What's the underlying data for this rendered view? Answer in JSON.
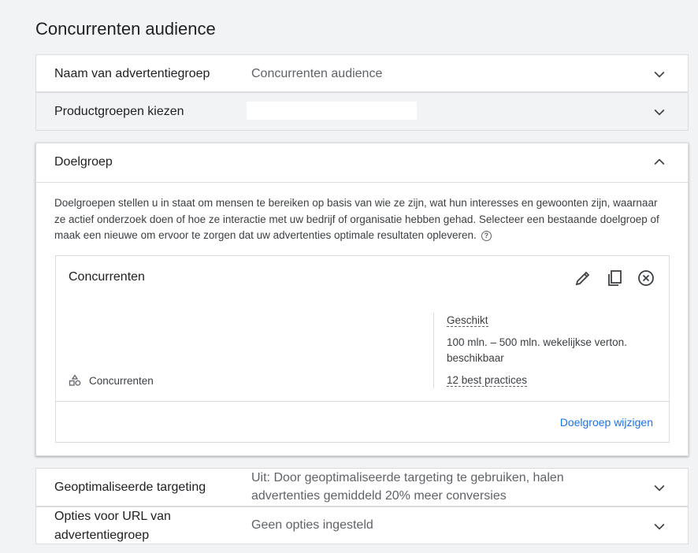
{
  "page": {
    "title": "Concurrenten audience"
  },
  "sections": {
    "ad_group_name": {
      "label": "Naam van advertentiegroep",
      "value": "Concurrenten audience"
    },
    "product_groups": {
      "label": "Productgroepen kiezen",
      "value": ""
    },
    "audience": {
      "label": "Doelgroep",
      "description": "Doelgroepen stellen u in staat om mensen te bereiken op basis van wie ze zijn, wat hun interesses en gewoonten zijn, waarnaar ze actief onderzoek doen of hoe ze interactie met uw bedrijf of organisatie hebben gehad. Selecteer een bestaande doelgroep of maak een nieuwe om ervoor te zorgen dat uw advertenties optimale resultaten opleveren.",
      "help_glyph": "?",
      "card": {
        "title": "Concurrenten",
        "segment_label": "Concurrenten",
        "status": "Geschikt",
        "impressions": "100 mln. – 500 mln. wekelijkse verton. beschikbaar",
        "best_practices": "12 best practices",
        "change_link": "Doelgroep wijzigen"
      }
    },
    "optimized_targeting": {
      "label": "Geoptimaliseerde targeting",
      "value": "Uit: Door geoptimaliseerde targeting te gebruiken, halen advertenties gemiddeld 20% meer conversies"
    },
    "url_options": {
      "label": "Opties voor URL van advertentiegroep",
      "value": "Geen opties ingesteld"
    }
  },
  "colors": {
    "accent": "#1a73e8",
    "border": "#dadce0",
    "background": "#f1f3f4"
  }
}
